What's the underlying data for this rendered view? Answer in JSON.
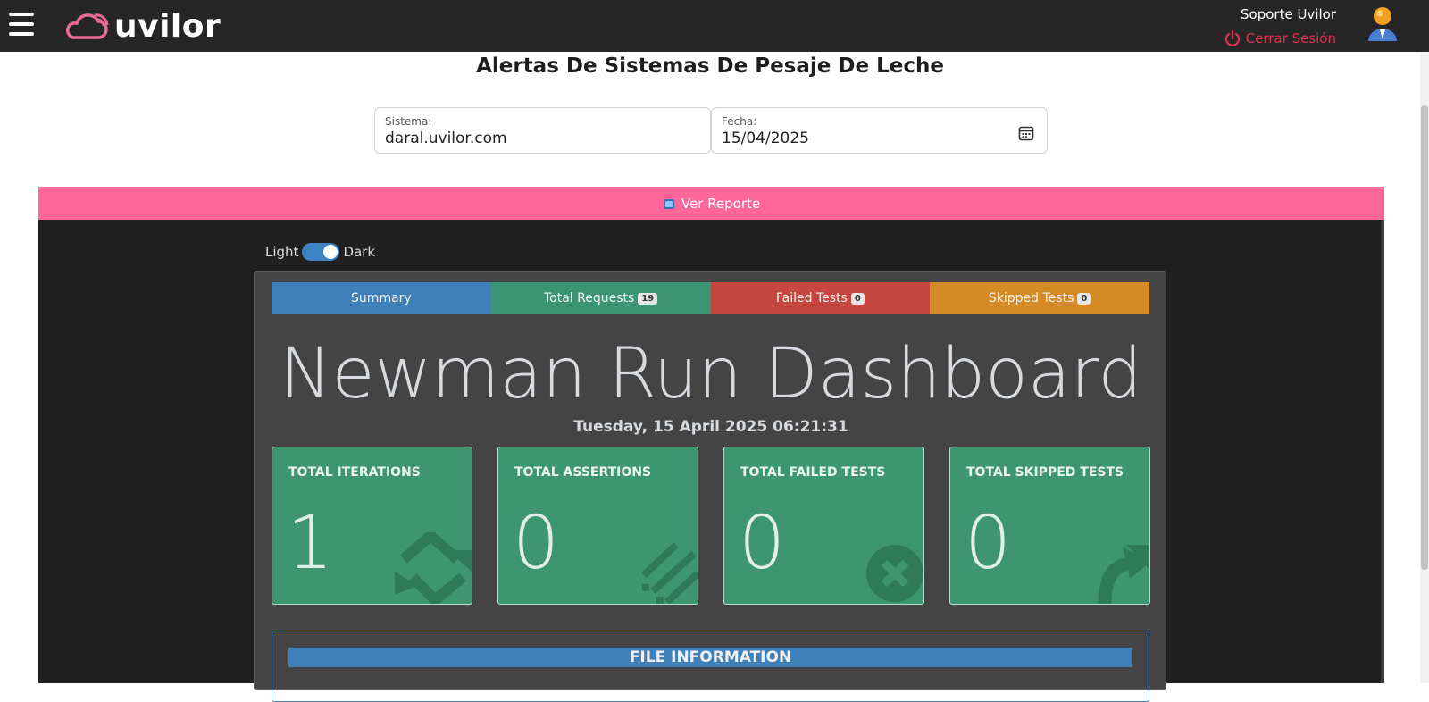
{
  "header": {
    "logo_text": "uvilor",
    "user_name": "Soporte Uvilor",
    "logout_label": "Cerrar Sesión"
  },
  "page": {
    "title": "Alertas De Sistemas De Pesaje De Leche"
  },
  "filters": {
    "system": {
      "label": "Sistema:",
      "value": "daral.uvilor.com"
    },
    "date": {
      "label": "Fecha:",
      "value": "15/04/2025"
    }
  },
  "report_bar": {
    "label": "Ver Reporte"
  },
  "report": {
    "theme": {
      "light_label": "Light",
      "dark_label": "Dark"
    },
    "tabs": [
      {
        "label": "Summary",
        "badge": ""
      },
      {
        "label": "Total Requests",
        "badge": "19"
      },
      {
        "label": "Failed Tests",
        "badge": "0"
      },
      {
        "label": "Skipped Tests",
        "badge": "0"
      }
    ],
    "title": "Newman Run Dashboard",
    "date": "Tuesday, 15 April 2025 06:21:31",
    "cards": [
      {
        "label": "TOTAL ITERATIONS",
        "value": "1",
        "icon": "repeat-icon"
      },
      {
        "label": "TOTAL ASSERTIONS",
        "value": "0",
        "icon": "tasks-icon"
      },
      {
        "label": "TOTAL FAILED TESTS",
        "value": "0",
        "icon": "close-circle-icon"
      },
      {
        "label": "TOTAL SKIPPED TESTS",
        "value": "0",
        "icon": "share-arrow-icon"
      }
    ],
    "file_info": {
      "title": "FILE INFORMATION"
    }
  },
  "colors": {
    "topbar": "#262626",
    "accent_pink": "#ff6699",
    "summary_tab": "#3f7fba",
    "requests_tab": "#3b9473",
    "failed_tab": "#c5463e",
    "skipped_tab": "#d48b26",
    "card_green": "#3e9572"
  }
}
